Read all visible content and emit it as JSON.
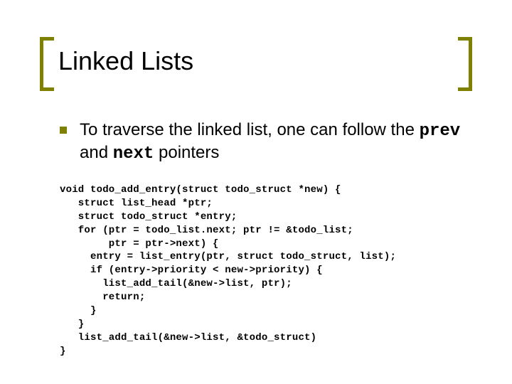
{
  "title": "Linked Lists",
  "bullet": {
    "pre": "To traverse the linked list, one can follow the ",
    "code1": "prev",
    "mid": " and ",
    "code2": "next",
    "post": " pointers"
  },
  "code": "void todo_add_entry(struct todo_struct *new) {\n   struct list_head *ptr;\n   struct todo_struct *entry;\n   for (ptr = todo_list.next; ptr != &todo_list;\n        ptr = ptr->next) {\n     entry = list_entry(ptr, struct todo_struct, list);\n     if (entry->priority < new->priority) {\n       list_add_tail(&new->list, ptr);\n       return;\n     }\n   }\n   list_add_tail(&new->list, &todo_struct)\n}"
}
